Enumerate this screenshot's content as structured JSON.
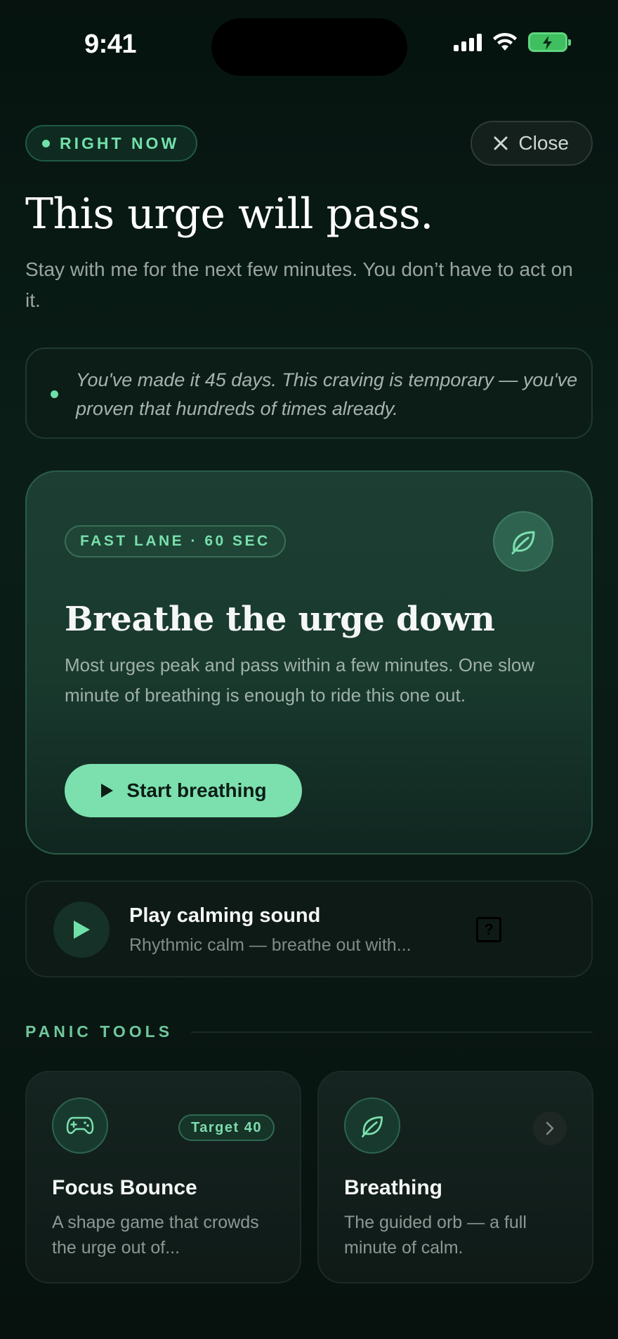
{
  "status_bar": {
    "time": "9:41"
  },
  "header": {
    "badge": "RIGHT NOW",
    "close_label": "Close",
    "title": "This urge will pass.",
    "subtitle": "Stay with me for the next few minutes. You don’t have to act on it."
  },
  "encouragement": {
    "text": "You've made it 45 days. This craving is temporary — you've proven that hundreds of times already."
  },
  "fast_lane": {
    "badge": "FAST LANE · 60 SEC",
    "icon": "leaf-icon",
    "title": "Breathe the urge down",
    "description": "Most urges peak and pass within a few minutes. One slow minute of breathing is enough to ride this one out.",
    "button_label": "Start breathing"
  },
  "sound": {
    "title": "Play calming sound",
    "subtitle": "Rhythmic calm — breathe out with...",
    "help_glyph": "?"
  },
  "panic_tools": {
    "section_label": "PANIC TOOLS",
    "tools": [
      {
        "icon": "gamepad-icon",
        "badge": "Target 40",
        "title": "Focus Bounce",
        "description": "A shape game that crowds the urge out of..."
      },
      {
        "icon": "leaf-icon",
        "title": "Breathing",
        "description": "The guided orb — a full minute of calm."
      }
    ]
  },
  "colors": {
    "accent": "#7ce0ae",
    "background": "#0a1a15",
    "card": "#1d3f33"
  }
}
